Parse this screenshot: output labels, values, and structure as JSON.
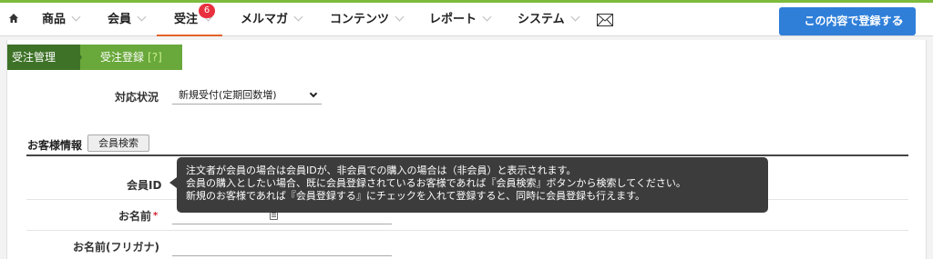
{
  "nav": {
    "items": [
      {
        "label": "商品"
      },
      {
        "label": "会員"
      },
      {
        "label": "受注",
        "badge": "6"
      },
      {
        "label": "メルマガ"
      },
      {
        "label": "コンテンツ"
      },
      {
        "label": "レポート"
      },
      {
        "label": "システム"
      }
    ],
    "register_button": "この内容で登録する",
    "register_arrow": "›",
    "active_color": "#e2622a",
    "accent_color": "#7dbb3c",
    "button_color": "#2f7fd9"
  },
  "breadcrumb": {
    "parent": "受注管理",
    "current": "受注登録",
    "help": "[?]"
  },
  "form": {
    "status_label": "対応状況",
    "status_value": "新規受付(定期回数増)",
    "customer_section": "お客様情報",
    "member_search_button": "会員検索",
    "member_id_label": "会員ID",
    "name_label": "お名前",
    "required_mark": "*",
    "kana_label": "お名前(フリガナ)"
  },
  "tooltip": {
    "line1": "注文者が会員の場合は会員IDが、非会員での購入の場合は（非会員）と表示されます。",
    "line2": "会員の購入としたい場合、既に会員登録されているお客様であれば『会員検索』ボタンから検索してください。",
    "line3": "新規のお客様であれば『会員登録する』にチェックを入れて登録すると、同時に会員登録も行えます。"
  }
}
